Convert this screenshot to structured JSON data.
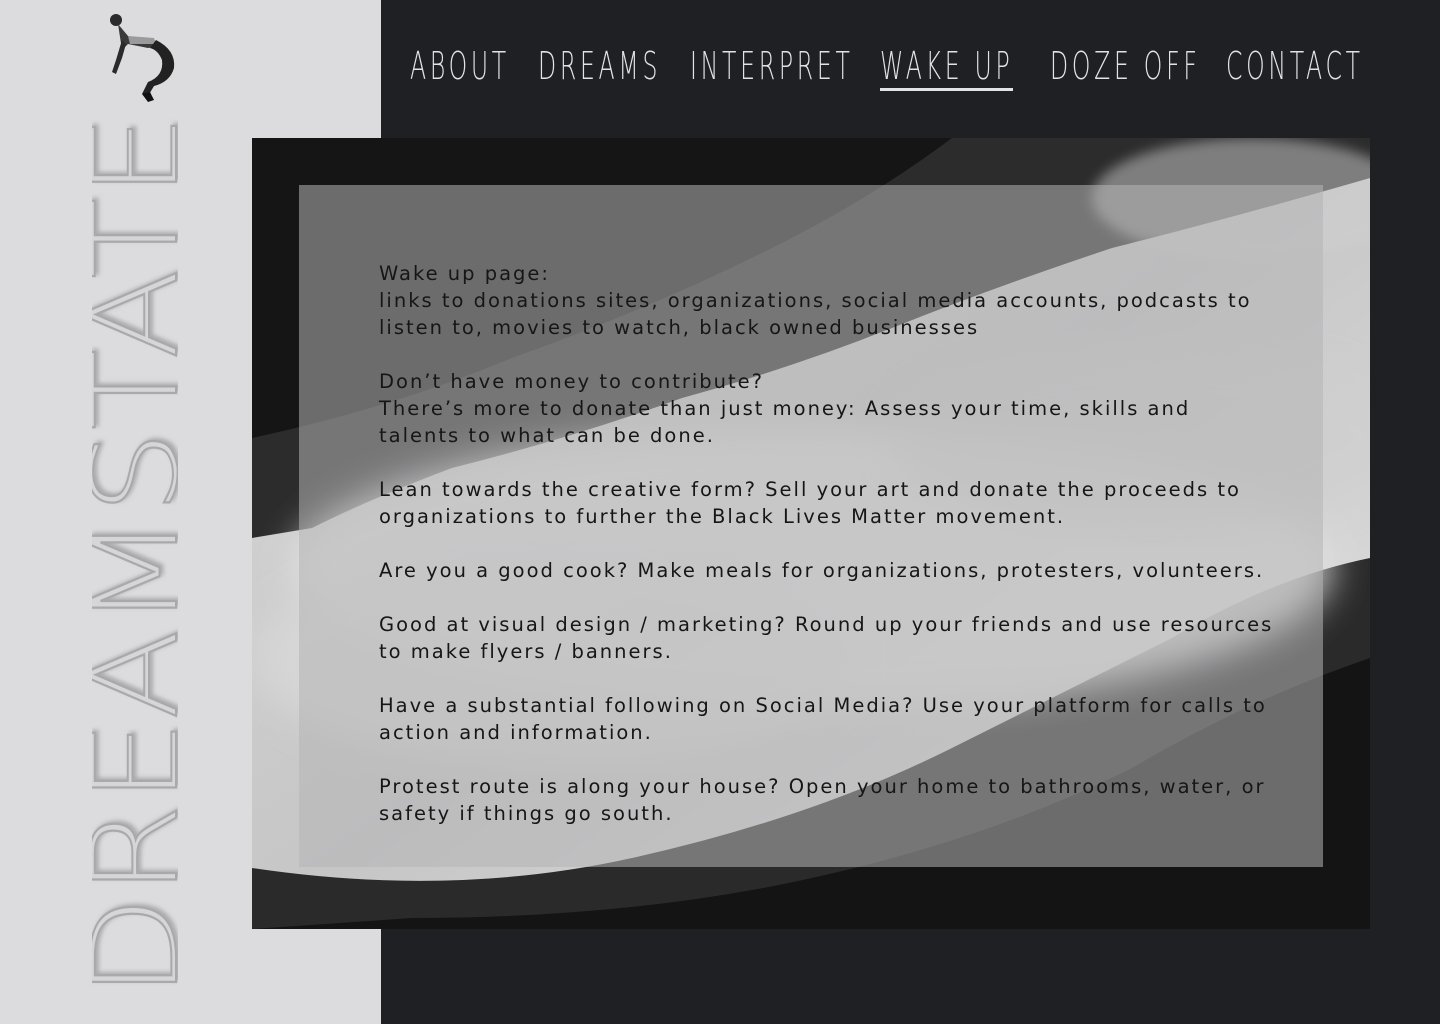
{
  "brand": {
    "name": "DREAMSTATE",
    "figure_icon": "jumping-person-figure"
  },
  "nav": {
    "items": [
      {
        "label": "About",
        "active": false
      },
      {
        "label": "Dreams",
        "active": false
      },
      {
        "label": "Interpret",
        "active": false
      },
      {
        "label": "Wake Up",
        "active": true
      },
      {
        "label": "Doze Off",
        "active": false
      },
      {
        "label": "Contact",
        "active": false
      }
    ]
  },
  "content": {
    "paragraphs": [
      "Wake up page:\n links to donations sites, organizations, social media accounts, podcasts to listen to, movies to watch, black owned businesses",
      "Don’t have money to contribute?\nThere’s more to donate than just money: Assess your time, skills and talents to what can be done.",
      "Lean towards the creative form?  Sell your art and donate the proceeds to organizations to further the Black Lives Matter movement.",
      "Are you a good cook?  Make meals for organizations, protesters, volunteers.",
      "Good at visual design / marketing?  Round up your friends and use resources to make flyers / banners.",
      "Have a substantial following on Social Media?  Use your platform for calls to action and information.",
      "Protest route is along your house?  Open your home to bathrooms, water, or safety if things go south."
    ]
  },
  "colors": {
    "background": "#1f2023",
    "sidebar": "#dcdcde",
    "nav_text": "#e3e3e5",
    "panel": "#b4b4b6",
    "body_text": "#161616"
  }
}
